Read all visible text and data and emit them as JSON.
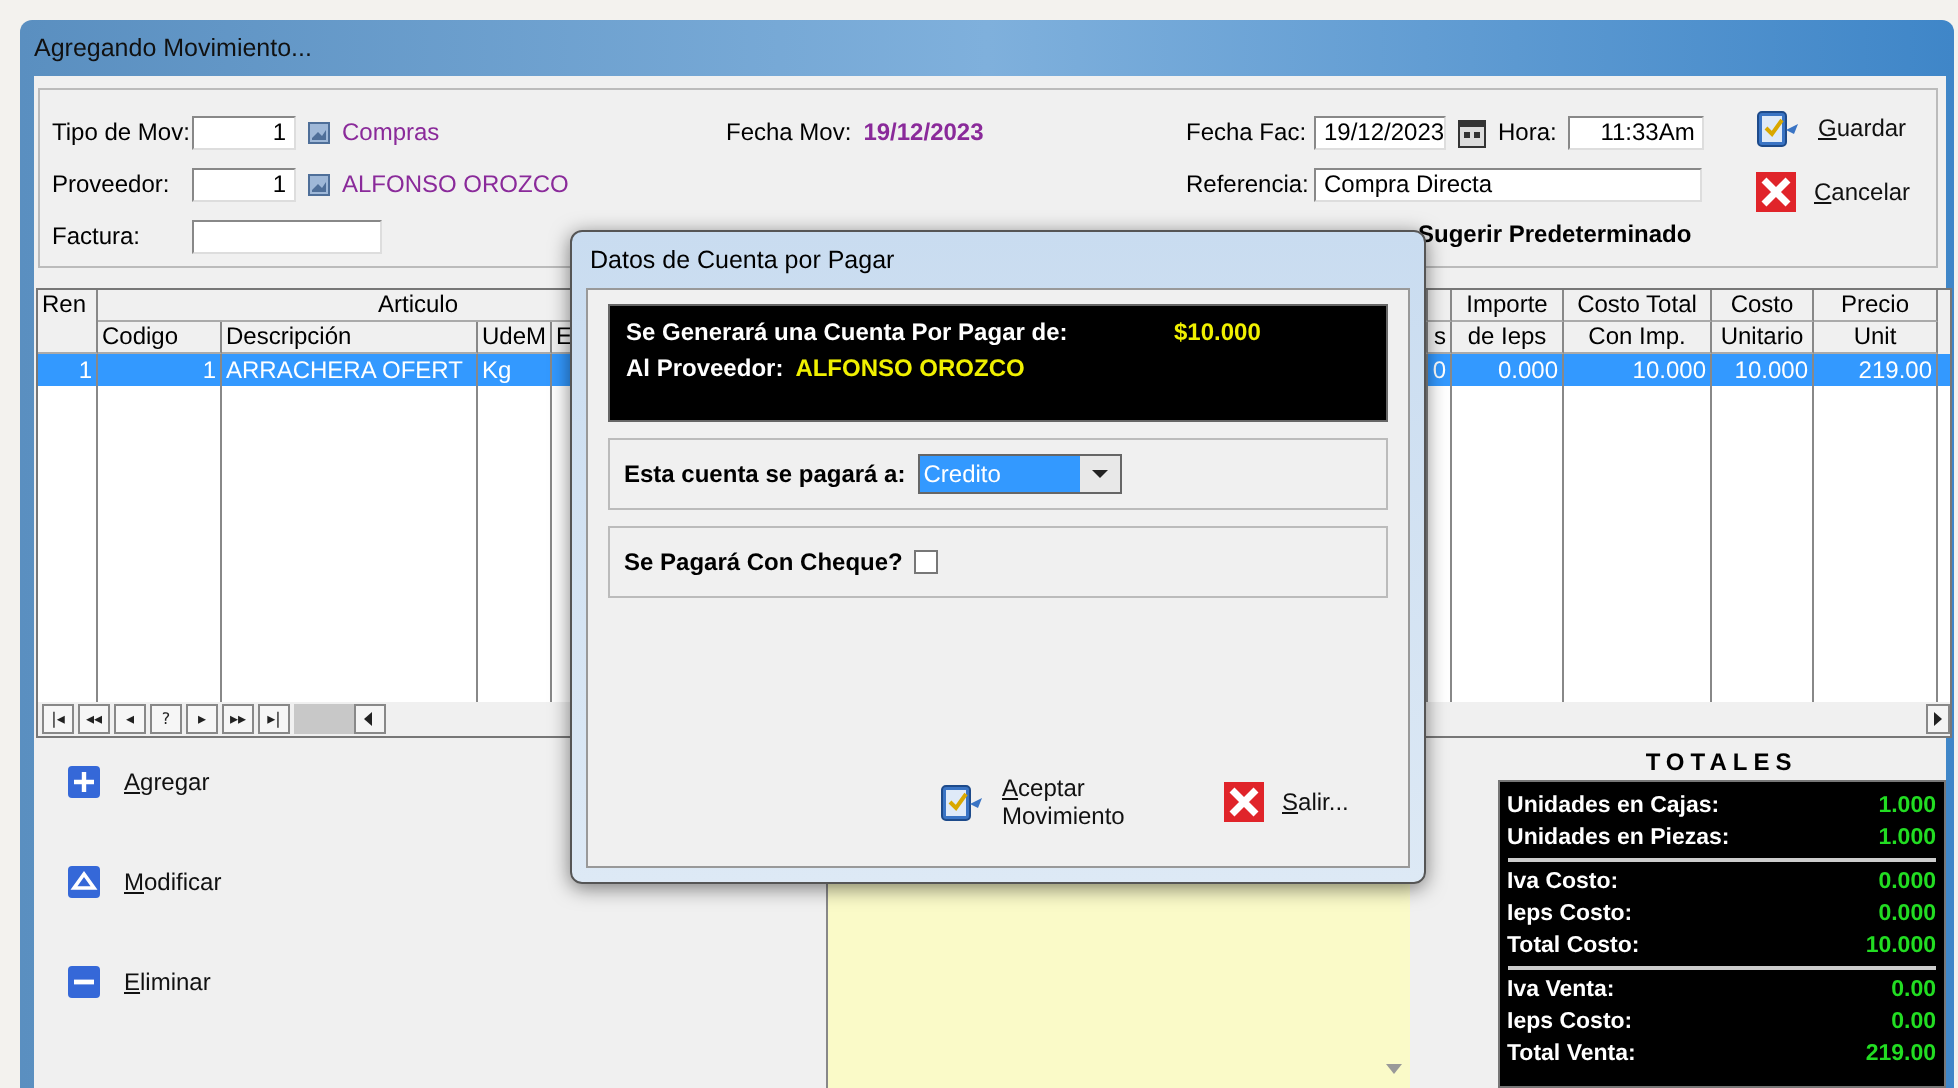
{
  "window": {
    "title": "Agregando Movimiento..."
  },
  "header": {
    "tipo_mov": {
      "label": "Tipo de Mov:",
      "value": "1",
      "name": "Compras"
    },
    "proveedor": {
      "label": "Proveedor:",
      "value": "1",
      "name": "ALFONSO OROZCO"
    },
    "factura": {
      "label": "Factura:"
    },
    "fecha_mov": {
      "label": "Fecha Mov:",
      "value": "19/12/2023"
    },
    "fecha_fac": {
      "label": "Fecha Fac:",
      "value": "19/12/2023"
    },
    "hora": {
      "label": "Hora:",
      "value": "11:33Am"
    },
    "referencia": {
      "label": "Referencia:",
      "value": "Compra Directa"
    },
    "sugerir": {
      "label": "Sugerir Predeterminado"
    }
  },
  "actions": [
    {
      "label": "Guardar",
      "kind": "save"
    },
    {
      "label": "Cancelar",
      "kind": "cancel"
    }
  ],
  "grid": {
    "group_label": "Articulo",
    "columns": [
      {
        "label": "Ren"
      },
      {
        "label": "Codigo"
      },
      {
        "label": "Descripción"
      },
      {
        "label": "UdeM"
      },
      {
        "label": "E"
      },
      {
        "label": "s"
      },
      {
        "label": "Importe",
        "sublabel": "de Ieps"
      },
      {
        "label": "Costo Total",
        "sublabel": "Con Imp."
      },
      {
        "label": "Costo",
        "sublabel": "Unitario"
      },
      {
        "label": "Precio",
        "sublabel": "Unit"
      }
    ],
    "rows": [
      {
        "selected": true,
        "cells": [
          "1",
          "1",
          "ARRACHERA OFERT",
          "Kg",
          "",
          "0",
          "0.000",
          "10.000",
          "10.000",
          "219.00"
        ]
      }
    ],
    "navigator": [
      "|◂",
      "◂◂",
      "◂",
      "?",
      "▸",
      "▸▸",
      "▸|"
    ]
  },
  "side_actions": [
    {
      "label": "Agregar",
      "kind": "add"
    },
    {
      "label": "Modificar",
      "kind": "edit"
    },
    {
      "label": "Eliminar",
      "kind": "delete"
    }
  ],
  "totals": {
    "title": "TOTALES",
    "sections": [
      {
        "rows": [
          {
            "label": "Unidades en Cajas:",
            "value": "1.000"
          },
          {
            "label": "Unidades en Piezas:",
            "value": "1.000"
          }
        ]
      },
      {
        "rows": [
          {
            "label": "Iva Costo:",
            "value": "0.000"
          },
          {
            "label": "Ieps Costo:",
            "value": "0.000"
          },
          {
            "label": "Total Costo:",
            "value": "10.000"
          }
        ]
      },
      {
        "rows": [
          {
            "label": "Iva Venta:",
            "value": "0.00"
          },
          {
            "label": "Ieps Costo:",
            "value": "0.00"
          },
          {
            "label": "Total Venta:",
            "value": "219.00"
          }
        ]
      }
    ]
  },
  "dialog": {
    "title": "Datos de Cuenta por Pagar",
    "summary": {
      "amount_label": "Se Generará una Cuenta Por Pagar de:",
      "amount": "$10.000",
      "supplier_label": "Al Proveedor:",
      "supplier": "ALFONSO OROZCO"
    },
    "pay_with": {
      "label": "Esta cuenta se pagará a:",
      "value": "Credito"
    },
    "cheque": {
      "label": "Se Pagará Con Cheque?",
      "checked": false
    },
    "buttons": [
      {
        "label": "Aceptar Movimiento",
        "kind": "accept"
      },
      {
        "label": "Salir...",
        "kind": "exit"
      }
    ]
  }
}
